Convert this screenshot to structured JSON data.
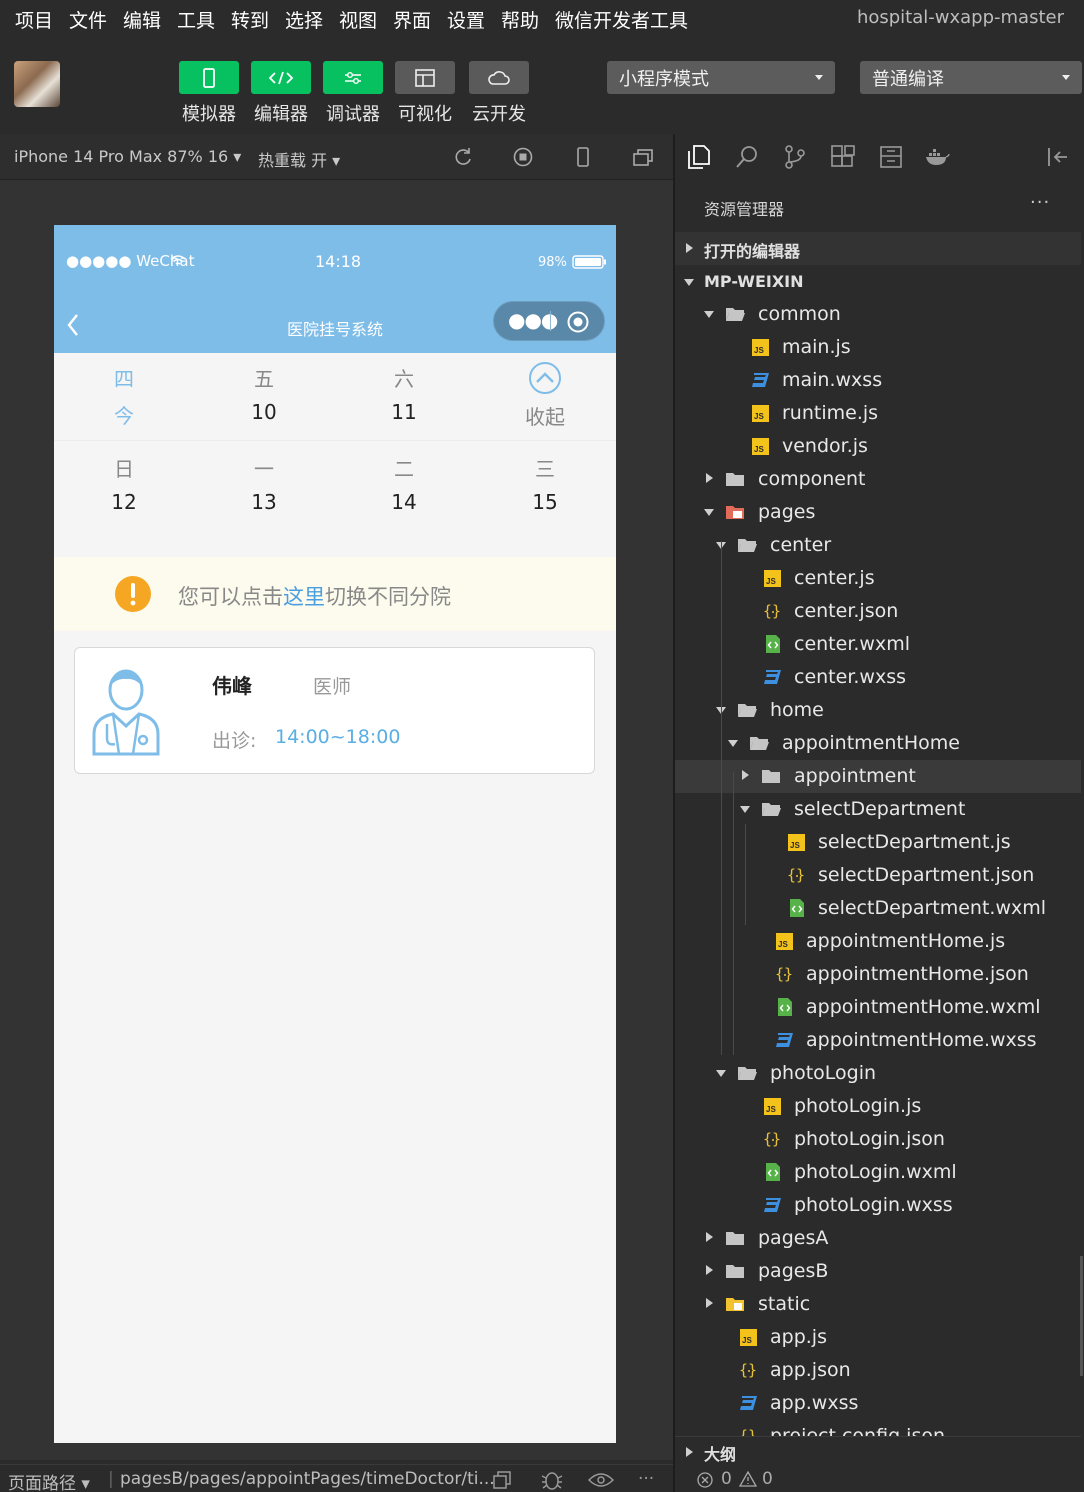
{
  "menu": [
    "项目",
    "文件",
    "编辑",
    "工具",
    "转到",
    "选择",
    "视图",
    "界面",
    "设置",
    "帮助",
    "微信开发者工具"
  ],
  "project_name": "hospital-wxapp-master",
  "toolbar": {
    "buttons": [
      "模拟器",
      "编辑器",
      "调试器",
      "可视化",
      "云开发"
    ],
    "mode_select": "小程序模式",
    "compile_select": "普通编译"
  },
  "simbar": {
    "device": "iPhone 14 Pro Max 87% 16",
    "hot_reload": "热重载 开"
  },
  "phone": {
    "carrier": "●●●●● WeChat",
    "time": "14:18",
    "battery": "98%",
    "nav_title": "医院挂号系统",
    "dates_row1": [
      {
        "week": "四",
        "day": "今",
        "active": true
      },
      {
        "week": "五",
        "day": "10"
      },
      {
        "week": "六",
        "day": "11"
      }
    ],
    "collapse_label": "收起",
    "dates_row2": [
      {
        "week": "日",
        "day": "12"
      },
      {
        "week": "一",
        "day": "13"
      },
      {
        "week": "二",
        "day": "14"
      },
      {
        "week": "三",
        "day": "15"
      }
    ],
    "notice_prefix": "您可以点击",
    "notice_link": "这里",
    "notice_suffix": "切换不同分院",
    "doctor": {
      "name": "伟峰",
      "title": "医师",
      "hours_label": "出诊:",
      "hours": "14:00~18:00"
    }
  },
  "bottom_left": {
    "path_label": "页面路径",
    "path": "pagesB/pages/appointPages/timeDoctor/ti..."
  },
  "explorer": {
    "title": "资源管理器",
    "more": "···",
    "open_editors": "打开的编辑器",
    "root": "MP-WEIXIN",
    "outline": "大纲",
    "errors": "0",
    "warnings": "0",
    "tree": [
      "common",
      "main.js",
      "main.wxss",
      "runtime.js",
      "vendor.js",
      "component",
      "pages",
      "center",
      "center.js",
      "center.json",
      "center.wxml",
      "center.wxss",
      "home",
      "appointmentHome",
      "appointment",
      "selectDepartment",
      "selectDepartment.js",
      "selectDepartment.json",
      "selectDepartment.wxml",
      "appointmentHome.js",
      "appointmentHome.json",
      "appointmentHome.wxml",
      "appointmentHome.wxss",
      "photoLogin",
      "photoLogin.js",
      "photoLogin.json",
      "photoLogin.wxml",
      "photoLogin.wxss",
      "pagesA",
      "pagesB",
      "static",
      "app.js",
      "app.json",
      "app.wxss",
      "project.config.json"
    ]
  },
  "colors": {
    "accent_green": "#07c160",
    "phone_header": "#7fbde9",
    "link_blue": "#4a9fe0",
    "warning_orange": "#f5a623"
  }
}
